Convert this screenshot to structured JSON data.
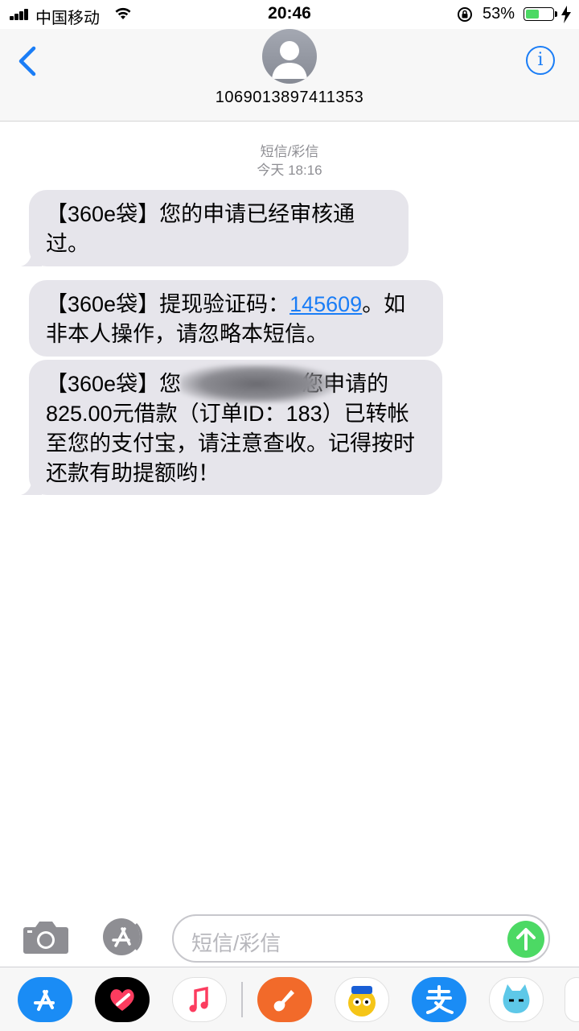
{
  "status_bar": {
    "carrier": "中国移动",
    "time": "20:46",
    "battery_percent": "53%",
    "battery_level": 0.53,
    "icons": [
      "signal-icon",
      "wifi-icon",
      "rotation-lock-icon",
      "battery-icon",
      "charging-bolt-icon"
    ]
  },
  "header": {
    "contact_number": "1069013897411353",
    "info_label": "i",
    "icons": [
      "back-chevron-icon",
      "contact-avatar-icon",
      "info-icon"
    ]
  },
  "thread": {
    "type_label": "短信/彩信",
    "timestamp": "今天 18:16",
    "messages": [
      {
        "text": "【360e袋】您的申请已经审核通过。"
      },
      {
        "prefix": "【360e袋】提现验证码：",
        "code": "145609",
        "suffix": "。如非本人操作，请忽略本短信。"
      },
      {
        "text_line1_a": "【360e袋】您",
        "text_line1_b": "您申请的",
        "text_rest": "825.00元借款（订单ID：183）已转帐至您的支付宝，请注意查收。记得按时还款有助提额哟！"
      }
    ]
  },
  "composer": {
    "placeholder": "短信/彩信",
    "icons": [
      "camera-icon",
      "app-store-icon",
      "send-arrow-icon"
    ]
  },
  "app_drawer": {
    "apps": [
      "app-store",
      "digital-touch",
      "music",
      "garageband",
      "cartoon-sticker",
      "alipay",
      "monster-sticker"
    ],
    "colors": {
      "appstore": "#1a8cf5",
      "music": "#fc3c5f",
      "garageband": "#f26a2a",
      "alipay": "#1a8cf5"
    }
  },
  "colors": {
    "link": "#1a7df6",
    "bubble": "#e6e5eb",
    "send": "#4cd964",
    "battery": "#4cd964"
  }
}
